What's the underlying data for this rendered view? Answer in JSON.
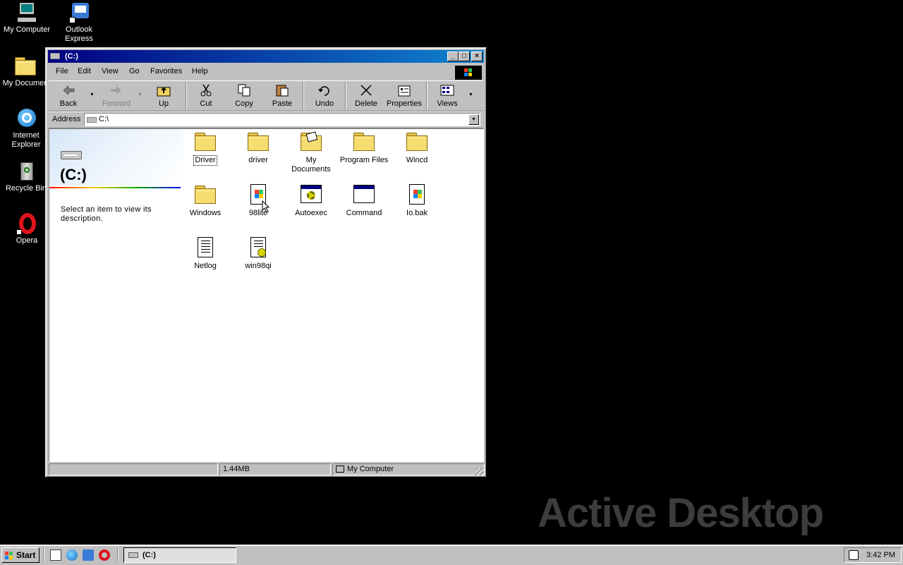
{
  "desktop": {
    "icons": [
      {
        "label": "My Computer"
      },
      {
        "label": "Outlook\nExpress"
      },
      {
        "label": "My Documen"
      },
      {
        "label": "Internet\nExplorer"
      },
      {
        "label": "Recycle Bin"
      },
      {
        "label": "Opera"
      }
    ],
    "watermark": "Active Desktop"
  },
  "window": {
    "title": "(C:)",
    "menu": [
      "File",
      "Edit",
      "View",
      "Go",
      "Favorites",
      "Help"
    ],
    "toolbar": {
      "back": "Back",
      "forward": "Forward",
      "up": "Up",
      "cut": "Cut",
      "copy": "Copy",
      "paste": "Paste",
      "undo": "Undo",
      "delete": "Delete",
      "properties": "Properties",
      "views": "Views"
    },
    "address": {
      "label": "Address",
      "value": "C:\\"
    },
    "left_pane": {
      "title": "(C:)",
      "description": "Select an item to view its description."
    },
    "files": [
      {
        "name": "Driver",
        "type": "folder"
      },
      {
        "name": "driver",
        "type": "folder"
      },
      {
        "name": "My Documents",
        "type": "folder"
      },
      {
        "name": "Program Files",
        "type": "folder"
      },
      {
        "name": "Wincd",
        "type": "folder"
      },
      {
        "name": "Windows",
        "type": "folder"
      },
      {
        "name": "98lite",
        "type": "app-doc"
      },
      {
        "name": "Autoexec",
        "type": "batch"
      },
      {
        "name": "Command",
        "type": "program"
      },
      {
        "name": "Io.bak",
        "type": "app-doc"
      },
      {
        "name": "Netlog",
        "type": "text"
      },
      {
        "name": "win98qi",
        "type": "text"
      }
    ],
    "status": {
      "size": "1.44MB",
      "zone": "My Computer"
    }
  },
  "taskbar": {
    "start": "Start",
    "task": "(C:)",
    "clock": "3:42 PM"
  },
  "colors": {
    "title_active_start": "#000080",
    "title_active_end": "#1084d0",
    "face": "#c0c0c0",
    "desktop": "#000000"
  }
}
